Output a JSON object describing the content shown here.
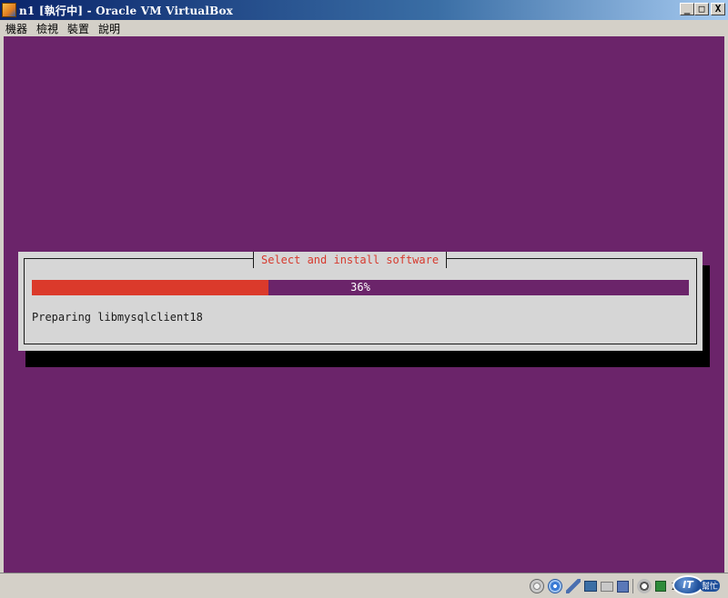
{
  "window": {
    "title": "n1 [執行中] - Oracle VM VirtualBox",
    "minimize_label": "_",
    "maximize_label": "□",
    "close_label": "X"
  },
  "menubar": {
    "items": [
      "機器",
      "檢視",
      "裝置",
      "說明"
    ]
  },
  "installer": {
    "dialog_title": "Select and install software",
    "progress_label": "36%",
    "progress_value": 36,
    "status_text": "Preparing libmysqlclient18"
  },
  "statusbar": {
    "icons": [
      "hard-disk-icon",
      "optical-drive-icon",
      "usb-icon",
      "network-icon",
      "shared-folder-icon",
      "display-icon",
      "mouse-capture-icon",
      "keyboard-capture-icon"
    ],
    "host_key_label": "R",
    "watermark_logo": "IT",
    "watermark_text": "幫忙"
  },
  "colors": {
    "vm_background": "#6b246a",
    "progress_fill": "#db3a2b",
    "dialog_title_text": "#d63a2e",
    "dialog_background": "#d6d6d6"
  }
}
